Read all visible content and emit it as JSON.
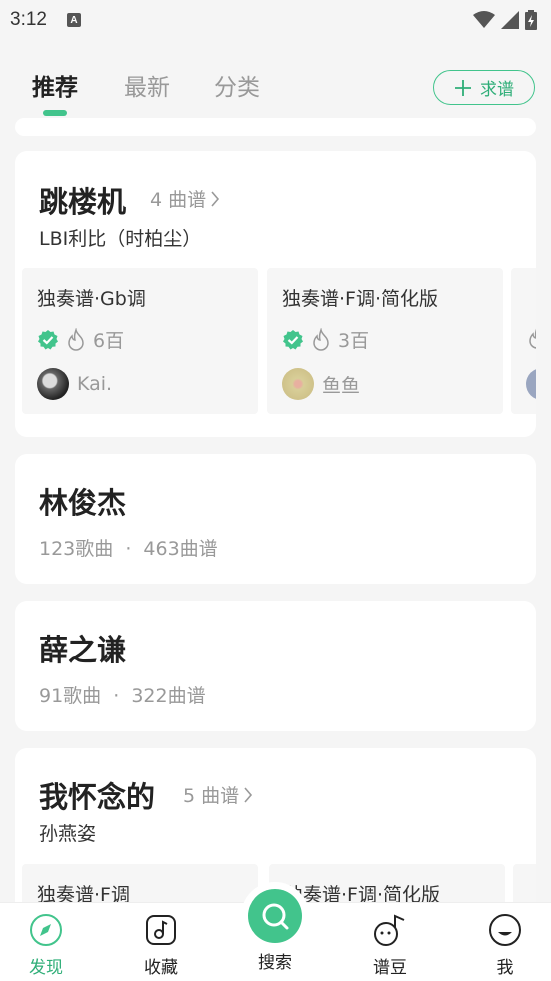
{
  "status": {
    "time": "3:12",
    "a_badge": "A"
  },
  "tabs": {
    "recommend": "推荐",
    "latest": "最新",
    "category": "分类"
  },
  "request_button": {
    "label": "求谱"
  },
  "song_card_1": {
    "title": "跳楼机",
    "count": "4 曲谱",
    "artist": "LBI利比（时柏尘）",
    "scores": [
      {
        "title": "独奏谱·Gb调",
        "heat": "6百",
        "user": "Kai."
      },
      {
        "title": "独奏谱·F调·简化版",
        "heat": "3百",
        "user": "鱼鱼"
      }
    ]
  },
  "artist_card_1": {
    "name": "林俊杰",
    "songs": "123歌曲",
    "dot": "·",
    "scores": "463曲谱"
  },
  "artist_card_2": {
    "name": "薛之谦",
    "songs": "91歌曲",
    "dot": "·",
    "scores": "322曲谱"
  },
  "song_card_2": {
    "title": "我怀念的",
    "count": "5 曲谱",
    "artist": "孙燕姿",
    "scores": [
      {
        "title": "独奏谱·F调"
      },
      {
        "title": "独奏谱·F调·简化版"
      }
    ]
  },
  "bottom_nav": {
    "discover": "发现",
    "favorites": "收藏",
    "search": "搜索",
    "beans": "谱豆",
    "me": "我"
  },
  "colors": {
    "accent": "#42c48c",
    "accent_text": "#2fae78"
  }
}
